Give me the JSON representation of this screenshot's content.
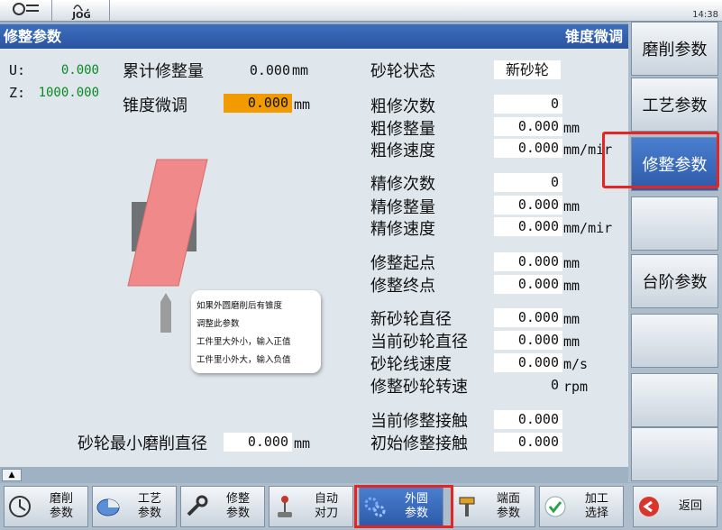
{
  "topbar": {
    "mode": "JOG",
    "time": "14:38"
  },
  "title": {
    "left": "修整参数",
    "right": "锥度微调"
  },
  "axes": [
    {
      "label": "U:",
      "value": "0.000"
    },
    {
      "label": "Z:",
      "value": "1000.000"
    }
  ],
  "left_params": {
    "cum_label": "累计修整量",
    "cum_value": "0.000",
    "cum_unit": "mm",
    "taper_label": "锥度微调",
    "taper_value": "0.000",
    "taper_unit": "mm",
    "min_dia_label": "砂轮最小磨削直径",
    "min_dia_value": "0.000",
    "min_dia_unit": "mm"
  },
  "right_params": [
    {
      "label": "砂轮状态",
      "value": "新砂轮",
      "unit": ""
    },
    {
      "label": "粗修次数",
      "value": "0",
      "unit": ""
    },
    {
      "label": "粗修整量",
      "value": "0.000",
      "unit": "mm"
    },
    {
      "label": "粗修速度",
      "value": "0.000",
      "unit": "mm/mir"
    },
    {
      "label": "精修次数",
      "value": "0",
      "unit": ""
    },
    {
      "label": "精修整量",
      "value": "0.000",
      "unit": "mm"
    },
    {
      "label": "精修速度",
      "value": "0.000",
      "unit": "mm/mir"
    },
    {
      "label": "修整起点",
      "value": "0.000",
      "unit": "mm"
    },
    {
      "label": "修整终点",
      "value": "0.000",
      "unit": "mm"
    },
    {
      "label": "新砂轮直径",
      "value": "0.000",
      "unit": "mm"
    },
    {
      "label": "当前砂轮直径",
      "value": "0.000",
      "unit": "mm"
    },
    {
      "label": "砂轮线速度",
      "value": "0.000",
      "unit": "m/s"
    },
    {
      "label": "修整砂轮转速",
      "value": "0",
      "unit": "rpm"
    },
    {
      "label": "当前修整接触",
      "value": "0.000",
      "unit": ""
    },
    {
      "label": "初始修整接触",
      "value": "0.000",
      "unit": ""
    }
  ],
  "tooltip": [
    "如果外圆磨削后有锥度",
    "调整此参数",
    "工件里大外小，输入正值",
    "工件里小外大，输入负值"
  ],
  "softkeys": [
    "磨削参数",
    "工艺参数",
    "修整参数",
    "",
    "台阶参数",
    "",
    "",
    ""
  ],
  "hkeys": [
    {
      "label": "磨削\n参数",
      "icon": "grinding-icon"
    },
    {
      "label": "工艺\n参数",
      "icon": "pie-chart-icon"
    },
    {
      "label": "修整\n参数",
      "icon": "wrench-icon"
    },
    {
      "label": "自动\n对刀",
      "icon": "joystick-icon"
    },
    {
      "label": "外圆\n参数",
      "icon": "gears-icon"
    },
    {
      "label": "端面\n参数",
      "icon": "hammer-icon"
    },
    {
      "label": "加工\n选择",
      "icon": "check-icon"
    },
    {
      "label": "返回",
      "icon": "back-arrow-icon"
    }
  ],
  "colors": {
    "title_bar": "#2b54a0",
    "axis_value": "#0a8a24",
    "highlight_field": "#f29b00",
    "annotation": "#e52424"
  }
}
